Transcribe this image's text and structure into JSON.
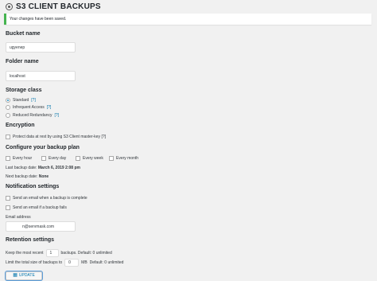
{
  "header": {
    "title": "S3 CLIENT BACKUPS",
    "icon": "gear-icon"
  },
  "notice": {
    "text": "Your changes have been saved."
  },
  "bucket": {
    "heading": "Bucket name",
    "value": "ugyenep"
  },
  "folder": {
    "heading": "Folder name",
    "value": "localhost"
  },
  "storage": {
    "heading": "Storage class",
    "options": [
      {
        "label": "Standard",
        "help": "[?]",
        "selected": true
      },
      {
        "label": "Infrequent Access",
        "help": "[?]",
        "selected": false
      },
      {
        "label": "Reduced Redundancy",
        "help": "[?]",
        "selected": false
      }
    ]
  },
  "encryption": {
    "heading": "Encryption",
    "label": "Protect data at rest by using S3 Client master-key [?]"
  },
  "plan": {
    "heading": "Configure your backup plan",
    "options": [
      "Every hour",
      "Every day",
      "Every week",
      "Every month"
    ],
    "last_label": "Last backup date:",
    "last_value": "March 6, 2019 2:08 pm",
    "next_label": "Next backup date:",
    "next_value": "None"
  },
  "notifications": {
    "heading": "Notification settings",
    "complete": "Send an email when a backup is complete",
    "fails": "Send an email if a backup fails",
    "email_label": "Email address",
    "email_value": "n@servmask.com"
  },
  "retention": {
    "heading": "Retention settings",
    "keep_label": "Keep the most recent",
    "keep_value": "1",
    "keep_suffix": "backups. Default: 0 unlimited",
    "limit_label": "Limit the total size of backups to",
    "limit_value": "0",
    "limit_unit": "MB",
    "limit_suffix": "Default: 0 unlimited"
  },
  "update_button": {
    "label": "UPDATE"
  },
  "colors": {
    "accent": "#0073aa",
    "success": "#46b450"
  }
}
